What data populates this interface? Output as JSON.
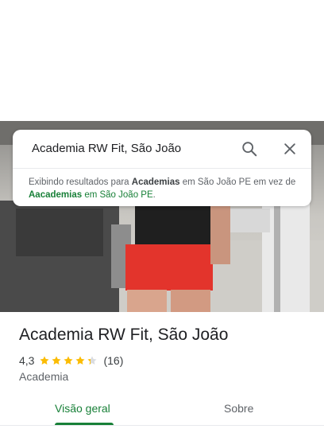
{
  "search": {
    "query": "Academia RW Fit, São João",
    "hint_prefix": "Exibindo resultados para ",
    "hint_term": "Academias",
    "hint_middle": " em São João PE em vez de ",
    "hint_original_term": "Aacademias",
    "hint_original_location": " em São João PE",
    "hint_end": "."
  },
  "place": {
    "name": "Academia RW Fit, São João",
    "rating": "4,3",
    "rating_value": 4.3,
    "reviews": "(16)",
    "category": "Academia"
  },
  "tabs": [
    {
      "label": "Visão geral",
      "active": true
    },
    {
      "label": "Sobre",
      "active": false
    }
  ],
  "colors": {
    "accent": "#188038",
    "star": "#fbbc04",
    "star_empty": "#dadce0"
  },
  "icons": [
    "search-icon",
    "close-icon",
    "star-icon"
  ]
}
